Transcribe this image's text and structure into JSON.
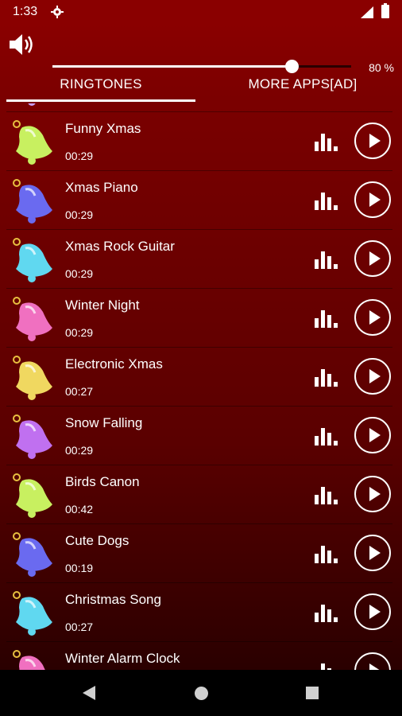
{
  "status": {
    "time": "1:33"
  },
  "volume": {
    "percent_label": "80 %",
    "level": 0.8
  },
  "tabs": {
    "ringtones": "RINGTONES",
    "more_apps": "MORE APPS[AD]"
  },
  "ringtones": [
    {
      "partial": true,
      "title": "",
      "duration": "",
      "color": "#c8a0ff"
    },
    {
      "title": "Funny Xmas",
      "duration": "00:29",
      "color": "#c8f060"
    },
    {
      "title": "Xmas Piano",
      "duration": "00:29",
      "color": "#6a6af0"
    },
    {
      "title": "Xmas Rock Guitar",
      "duration": "00:29",
      "color": "#60d8f0"
    },
    {
      "title": "Winter Night",
      "duration": "00:29",
      "color": "#f070c0"
    },
    {
      "title": "Electronic Xmas",
      "duration": "00:27",
      "color": "#f0d860"
    },
    {
      "title": "Snow Falling",
      "duration": "00:29",
      "color": "#c070f0"
    },
    {
      "title": "Birds Canon",
      "duration": "00:42",
      "color": "#c8f060"
    },
    {
      "title": "Cute Dogs",
      "duration": "00:19",
      "color": "#6a6af0"
    },
    {
      "title": "Christmas Song",
      "duration": "00:27",
      "color": "#60d8f0"
    },
    {
      "title": "Winter Alarm Clock",
      "duration": "",
      "color": "#f070c0"
    }
  ]
}
